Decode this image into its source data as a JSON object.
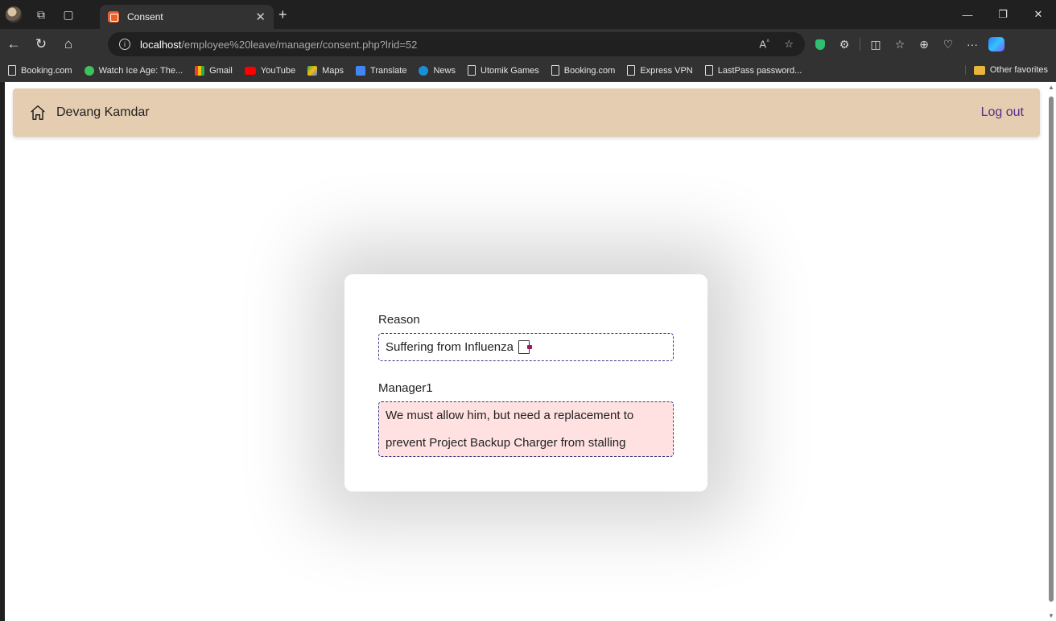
{
  "browser": {
    "tab": {
      "title": "Consent"
    },
    "address": {
      "host": "localhost",
      "path": "/employee%20leave/manager/consent.php?lrid=52"
    },
    "bookmarks": [
      {
        "label": "Booking.com",
        "icon": "page-icon"
      },
      {
        "label": "Watch Ice Age: The...",
        "icon": "play-icon"
      },
      {
        "label": "Gmail",
        "icon": "gmail-icon"
      },
      {
        "label": "YouTube",
        "icon": "youtube-icon"
      },
      {
        "label": "Maps",
        "icon": "maps-icon"
      },
      {
        "label": "Translate",
        "icon": "translate-icon"
      },
      {
        "label": "News",
        "icon": "news-icon"
      },
      {
        "label": "Utomik Games",
        "icon": "page-icon"
      },
      {
        "label": "Booking.com",
        "icon": "page-icon"
      },
      {
        "label": "Express VPN",
        "icon": "page-icon"
      },
      {
        "label": "LastPass password...",
        "icon": "page-icon"
      }
    ],
    "other_favorites": "Other favorites"
  },
  "header": {
    "user_name": "Devang Kamdar",
    "logout_label": "Log out"
  },
  "consent": {
    "reason_label": "Reason",
    "reason_value": "Suffering from Influenza",
    "manager_label": "Manager1",
    "manager_value": "We must allow him, but need a replacement to prevent Project Backup Charger from stalling"
  },
  "colors": {
    "header_bg": "#e4cdb0",
    "logout_link": "#5a2b8a",
    "manager_field_bg": "#ffe1e1"
  }
}
